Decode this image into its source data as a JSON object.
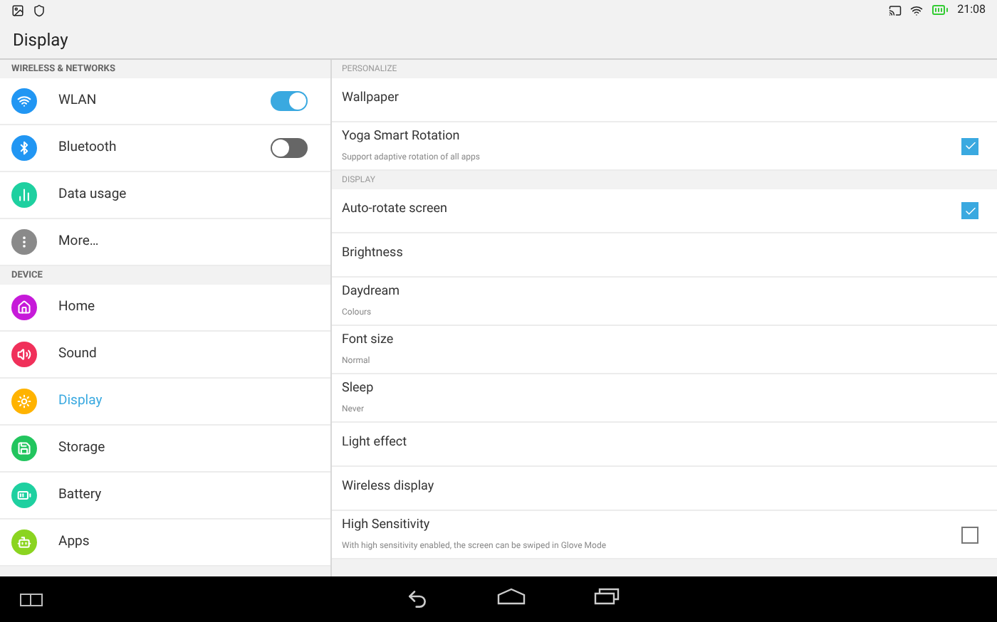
{
  "status_bar": {
    "time": "21:08"
  },
  "title": "Display",
  "sidebar": {
    "sections": [
      {
        "header": "WIRELESS & NETWORKS",
        "items": [
          {
            "label": "WLAN",
            "color": "#2196f3",
            "kind": "switch",
            "on": true,
            "selected": false
          },
          {
            "label": "Bluetooth",
            "color": "#2196f3",
            "kind": "switch",
            "on": false,
            "selected": false
          },
          {
            "label": "Data usage",
            "color": "#1ed0a0",
            "kind": "plain",
            "selected": false
          },
          {
            "label": "More…",
            "color": "#8a8a8a",
            "kind": "plain",
            "selected": false
          }
        ]
      },
      {
        "header": "DEVICE",
        "items": [
          {
            "label": "Home",
            "color": "#c61ad9",
            "kind": "plain",
            "selected": false
          },
          {
            "label": "Sound",
            "color": "#f0305a",
            "kind": "plain",
            "selected": false
          },
          {
            "label": "Display",
            "color": "#ffb300",
            "kind": "plain",
            "selected": true
          },
          {
            "label": "Storage",
            "color": "#22c55e",
            "kind": "plain",
            "selected": false
          },
          {
            "label": "Battery",
            "color": "#1ed0a0",
            "kind": "plain",
            "selected": false
          },
          {
            "label": "Apps",
            "color": "#8bd420",
            "kind": "plain",
            "selected": false
          }
        ]
      }
    ]
  },
  "settings": {
    "sections": [
      {
        "header": "PERSONALIZE",
        "items": [
          {
            "title": "Wallpaper",
            "kind": "plain"
          },
          {
            "title": "Yoga Smart Rotation",
            "summary": "Support adaptive rotation of all apps",
            "kind": "checkbox",
            "checked": true
          }
        ]
      },
      {
        "header": "DISPLAY",
        "items": [
          {
            "title": "Auto-rotate screen",
            "kind": "checkbox",
            "checked": true
          },
          {
            "title": "Brightness",
            "kind": "plain"
          },
          {
            "title": "Daydream",
            "summary": "Colours",
            "kind": "plain"
          },
          {
            "title": "Font size",
            "summary": "Normal",
            "kind": "plain"
          },
          {
            "title": "Sleep",
            "summary": "Never",
            "kind": "plain"
          },
          {
            "title": "Light effect",
            "kind": "plain"
          },
          {
            "title": "Wireless display",
            "kind": "plain"
          },
          {
            "title": "High Sensitivity",
            "summary": "With high sensitivity enabled, the screen can be swiped in Glove Mode",
            "kind": "checkbox",
            "checked": false
          }
        ]
      }
    ]
  }
}
